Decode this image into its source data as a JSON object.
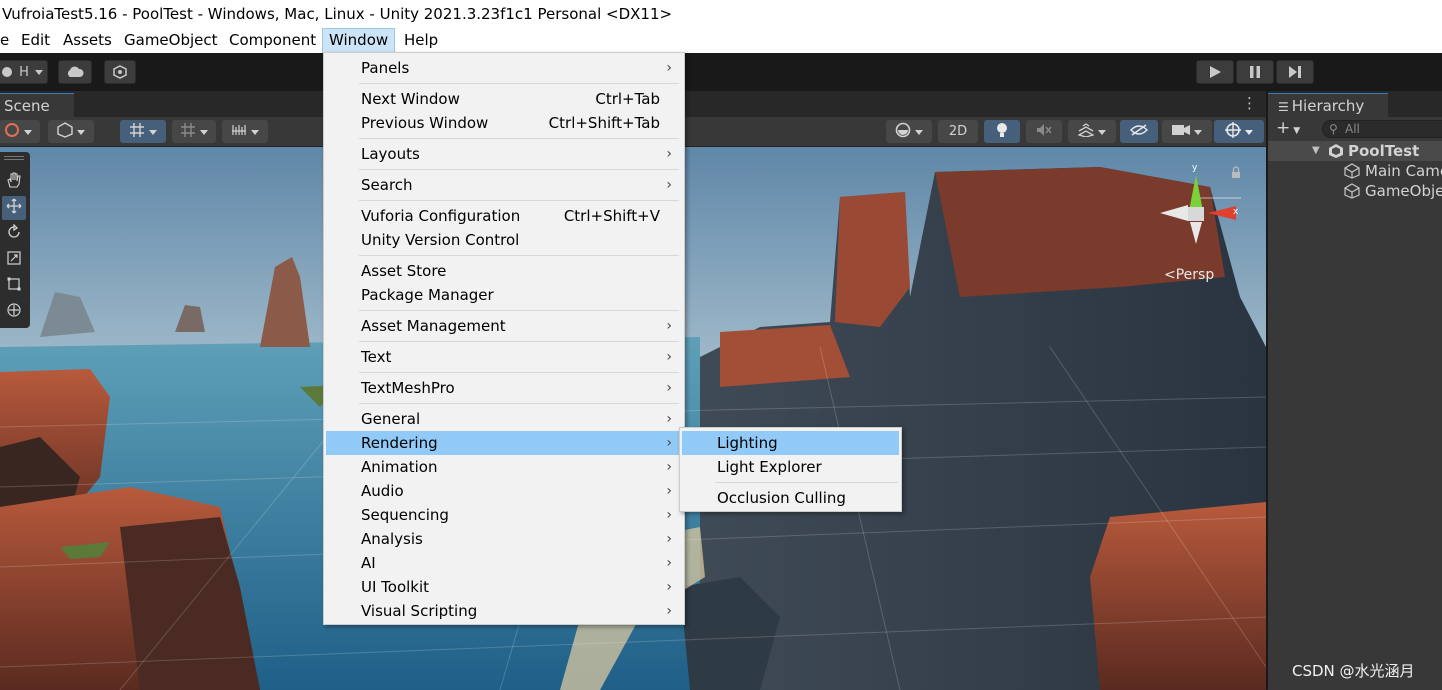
{
  "window": {
    "title": "VufroiaTest5.16 - PoolTest - Windows, Mac, Linux - Unity 2021.3.23f1c1 Personal <DX11>"
  },
  "menubar": {
    "file": "e",
    "edit": "Edit",
    "assets": "Assets",
    "gameobject": "GameObject",
    "component": "Component",
    "window": "Window",
    "help": "Help"
  },
  "toolbar": {
    "account_label": "H"
  },
  "scene": {
    "tab_label": "Scene",
    "toggle_2d": "2D",
    "view_label": "Persp",
    "gizmo_axes": {
      "x": "x",
      "y": "y"
    }
  },
  "hierarchy": {
    "tab_label": "Hierarchy",
    "search_placeholder": "All",
    "scene_name": "PoolTest",
    "items": [
      "Main Came",
      "GameObjec"
    ]
  },
  "window_menu": {
    "items": [
      {
        "label": "Panels",
        "shortcut": "",
        "submenu": true
      },
      {
        "label": "Next Window",
        "shortcut": "Ctrl+Tab",
        "submenu": false
      },
      {
        "label": "Previous Window",
        "shortcut": "Ctrl+Shift+Tab",
        "submenu": false
      },
      {
        "label": "Layouts",
        "shortcut": "",
        "submenu": true
      },
      {
        "label": "Search",
        "shortcut": "",
        "submenu": true
      },
      {
        "label": "Vuforia Configuration",
        "shortcut": "Ctrl+Shift+V",
        "submenu": false
      },
      {
        "label": "Unity Version Control",
        "shortcut": "",
        "submenu": false
      },
      {
        "label": "Asset Store",
        "shortcut": "",
        "submenu": false
      },
      {
        "label": "Package Manager",
        "shortcut": "",
        "submenu": false
      },
      {
        "label": "Asset Management",
        "shortcut": "",
        "submenu": true
      },
      {
        "label": "Text",
        "shortcut": "",
        "submenu": true
      },
      {
        "label": "TextMeshPro",
        "shortcut": "",
        "submenu": true
      },
      {
        "label": "General",
        "shortcut": "",
        "submenu": true
      },
      {
        "label": "Rendering",
        "shortcut": "",
        "submenu": true,
        "highlighted": true
      },
      {
        "label": "Animation",
        "shortcut": "",
        "submenu": true
      },
      {
        "label": "Audio",
        "shortcut": "",
        "submenu": true
      },
      {
        "label": "Sequencing",
        "shortcut": "",
        "submenu": true
      },
      {
        "label": "Analysis",
        "shortcut": "",
        "submenu": true
      },
      {
        "label": "AI",
        "shortcut": "",
        "submenu": true
      },
      {
        "label": "UI Toolkit",
        "shortcut": "",
        "submenu": true
      },
      {
        "label": "Visual Scripting",
        "shortcut": "",
        "submenu": true
      }
    ]
  },
  "rendering_submenu": {
    "items": [
      {
        "label": "Lighting",
        "highlighted": true
      },
      {
        "label": "Light Explorer"
      },
      {
        "label": "Occlusion Culling"
      }
    ]
  },
  "watermark": "CSDN @水光涵月",
  "colors": {
    "menu_highlight": "#91c9f7",
    "menubar_active": "#cce4f7",
    "editor_dark": "#383838",
    "toolbar_dark": "#191919",
    "selection_blue": "#46607c"
  },
  "icons": [
    "play-icon",
    "pause-icon",
    "step-icon",
    "cloud-icon",
    "services-icon",
    "hand-tool-icon",
    "move-tool-icon",
    "rotate-tool-icon",
    "scale-tool-icon",
    "rect-tool-icon",
    "transform-tool-icon",
    "light-bulb-icon",
    "audio-mute-icon",
    "effects-icon",
    "hidden-icon",
    "camera-icon",
    "gizmo-icon",
    "kebab-icon",
    "lock-icon",
    "gameobject-icon",
    "unity-scene-icon"
  ]
}
